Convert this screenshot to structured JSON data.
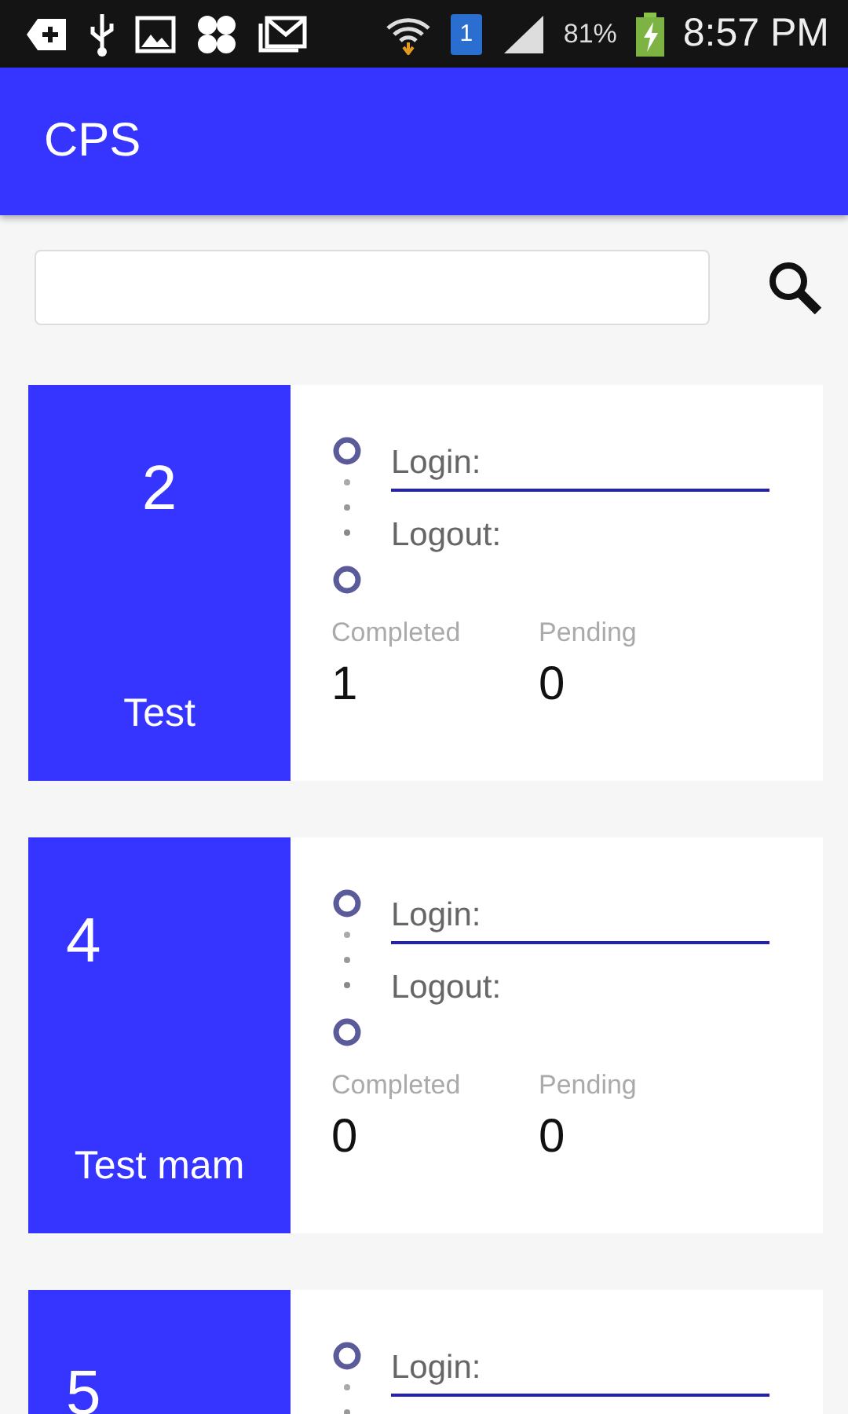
{
  "status_bar": {
    "sim": "1",
    "battery": "81%",
    "time": "8:57 PM"
  },
  "app_bar": {
    "title": "CPS"
  },
  "cards": [
    {
      "number": "2",
      "number_centered": true,
      "name": "Test",
      "login": "Login:",
      "logout": "Logout:",
      "completed_label": "Completed",
      "completed": "1",
      "pending_label": "Pending",
      "pending": "0"
    },
    {
      "number": "4",
      "number_centered": false,
      "name": "Test mam",
      "login": "Login:",
      "logout": "Logout:",
      "completed_label": "Completed",
      "completed": "0",
      "pending_label": "Pending",
      "pending": "0"
    },
    {
      "number": "5",
      "number_centered": false,
      "login": "Login:"
    }
  ]
}
